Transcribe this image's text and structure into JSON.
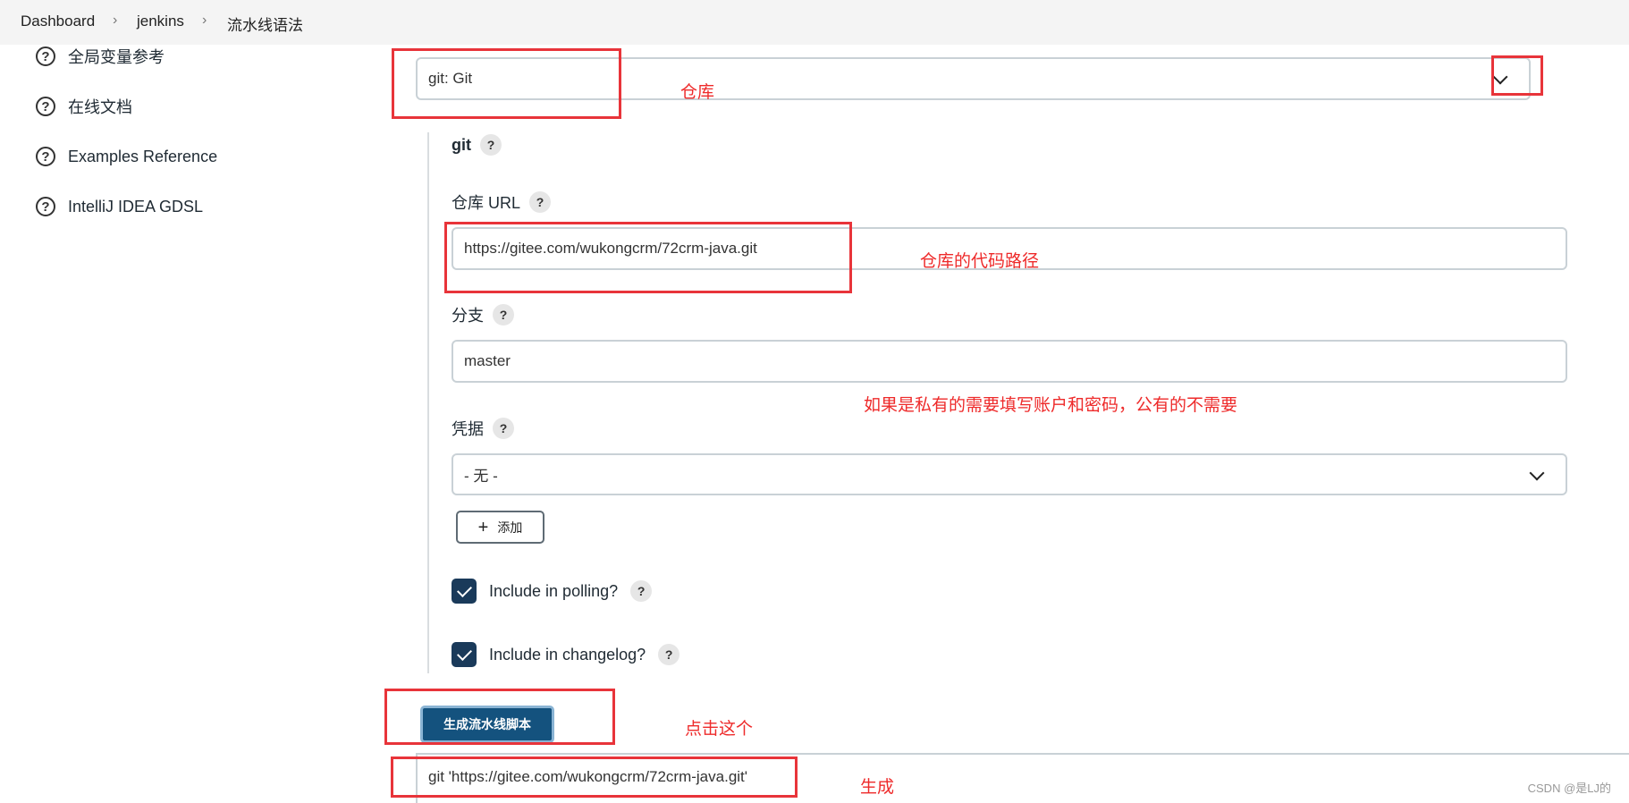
{
  "breadcrumb": [
    "Dashboard",
    "jenkins",
    "流水线语法"
  ],
  "sidebar": {
    "items": [
      {
        "label": "全局变量参考"
      },
      {
        "label": "在线文档"
      },
      {
        "label": "Examples Reference"
      },
      {
        "label": "IntelliJ IDEA GDSL"
      }
    ]
  },
  "sample_step": {
    "value": "git: Git"
  },
  "section": {
    "title": "git"
  },
  "repo_url": {
    "label": "仓库 URL",
    "value": "https://gitee.com/wukongcrm/72crm-java.git"
  },
  "branch": {
    "label": "分支",
    "value": "master"
  },
  "credentials": {
    "label": "凭据",
    "value": "- 无 -",
    "add_label": "添加"
  },
  "checkboxes": [
    {
      "label": "Include in polling?",
      "checked": true
    },
    {
      "label": "Include in changelog?",
      "checked": true
    }
  ],
  "generate": {
    "label": "生成流水线脚本"
  },
  "output": {
    "value": "git 'https://gitee.com/wukongcrm/72crm-java.git'"
  },
  "annotations": {
    "repo": "仓库",
    "url": "仓库的代码路径",
    "credentials": "如果是私有的需要填写账户和密码，公有的不需要",
    "click": "点击这个",
    "generated": "生成"
  },
  "watermark": "CSDN @是LJ的",
  "colors": {
    "accent": "#14527e",
    "annotation": "#e8343a",
    "checkbox": "#1a3a5a"
  }
}
